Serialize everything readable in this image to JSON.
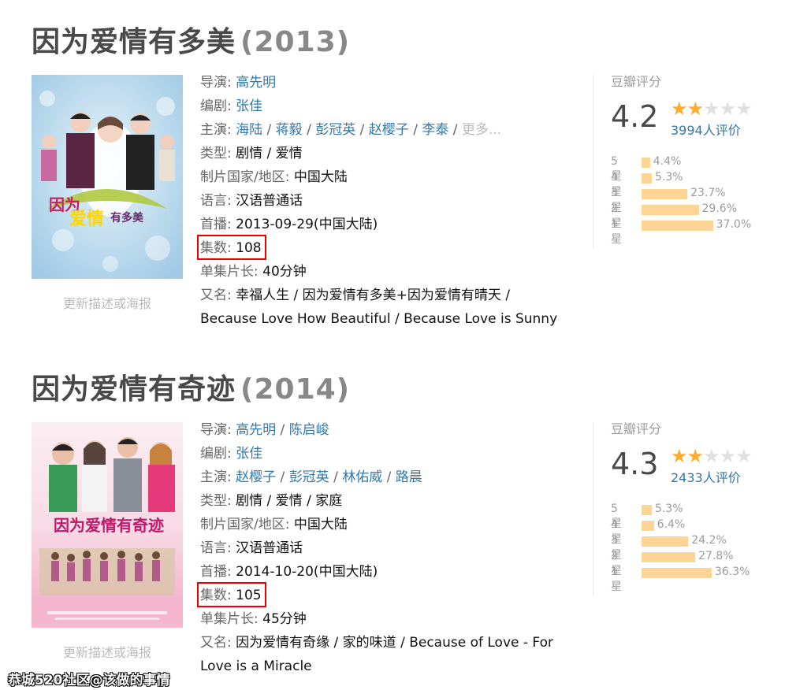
{
  "entries": [
    {
      "title": "因为爱情有多美",
      "year": "(2013)",
      "poster_alt": "因为爱情有多美 poster",
      "update_link": "更新描述或海报",
      "labels": {
        "director": "导演:",
        "writer": "编剧:",
        "cast": "主演:",
        "genre": "类型:",
        "country": "制片国家/地区:",
        "language": "语言:",
        "premiere": "首播:",
        "episodes": "集数:",
        "runtime": "单集片长:",
        "aka": "又名:"
      },
      "directors": [
        "高先明"
      ],
      "writers": [
        "张佳"
      ],
      "cast": [
        "海陆",
        "蒋毅",
        "彭冠英",
        "赵樱子",
        "李泰"
      ],
      "cast_more": "更多...",
      "genre": "剧情 / 爱情",
      "country": "中国大陆",
      "language": "汉语普通话",
      "premiere": "2013-09-29(中国大陆)",
      "episodes": "108",
      "runtime": "40分钟",
      "aka_line1": "幸福人生 / 因为爱情有多美+因为爱情有晴天 /",
      "aka_line2": "Because Love How Beautiful / Because Love is Sunny",
      "rating": {
        "label": "豆瓣评分",
        "score": "4.2",
        "stars_filled": 2,
        "stars_total": 5,
        "votes": "3994人评价",
        "distribution": [
          {
            "label": "5星",
            "pct": "4.4%",
            "value": 4.4
          },
          {
            "label": "4星",
            "pct": "5.3%",
            "value": 5.3
          },
          {
            "label": "3星",
            "pct": "23.7%",
            "value": 23.7
          },
          {
            "label": "2星",
            "pct": "29.6%",
            "value": 29.6
          },
          {
            "label": "1星",
            "pct": "37.0%",
            "value": 37.0
          }
        ]
      }
    },
    {
      "title": "因为爱情有奇迹",
      "year": "(2014)",
      "poster_alt": "因为爱情有奇迹 poster",
      "update_link": "更新描述或海报",
      "labels": {
        "director": "导演:",
        "writer": "编剧:",
        "cast": "主演:",
        "genre": "类型:",
        "country": "制片国家/地区:",
        "language": "语言:",
        "premiere": "首播:",
        "episodes": "集数:",
        "runtime": "单集片长:",
        "aka": "又名:"
      },
      "directors": [
        "高先明",
        "陈启峻"
      ],
      "writers": [
        "张佳"
      ],
      "cast": [
        "赵樱子",
        "彭冠英",
        "林佑威",
        "路晨"
      ],
      "cast_more": "",
      "genre": "剧情 / 爱情 / 家庭",
      "country": "中国大陆",
      "language": "汉语普通话",
      "premiere": "2014-10-20(中国大陆)",
      "episodes": "105",
      "runtime": "45分钟",
      "aka_line1": "因为爱情有奇缘 / 家的味道 / Because of Love - For",
      "aka_line2": "Love is a Miracle",
      "rating": {
        "label": "豆瓣评分",
        "score": "4.3",
        "stars_filled": 2,
        "stars_total": 5,
        "votes": "2433人评价",
        "distribution": [
          {
            "label": "5星",
            "pct": "5.3%",
            "value": 5.3
          },
          {
            "label": "4星",
            "pct": "6.4%",
            "value": 6.4
          },
          {
            "label": "3星",
            "pct": "24.2%",
            "value": 24.2
          },
          {
            "label": "2星",
            "pct": "27.8%",
            "value": 27.8
          },
          {
            "label": "1星",
            "pct": "36.3%",
            "value": 36.3
          }
        ]
      }
    }
  ],
  "watermark": "恭城520社区@该做的事情",
  "colors": {
    "link": "#3377aa",
    "star": "#ffac2d",
    "bar": "#ffd596",
    "highlight_box": "#ee0000"
  }
}
